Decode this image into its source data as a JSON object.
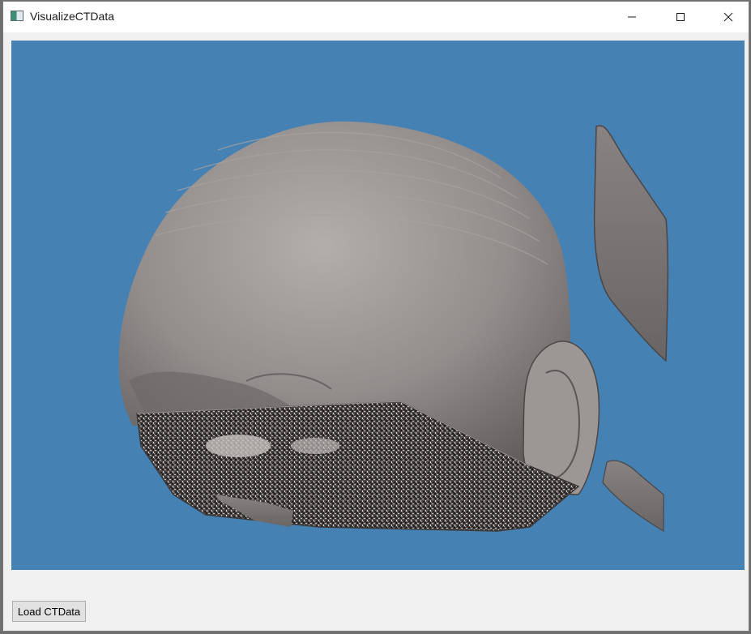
{
  "window": {
    "title": "VisualizeCTData",
    "icon": "app-window-icon"
  },
  "controls": {
    "minimize_icon": "minimize-icon",
    "maximize_icon": "maximize-icon",
    "close_icon": "close-icon"
  },
  "viewport": {
    "background_color": "#4681b4",
    "surface_color": "#8f8a89",
    "content": "3D CT head surface rendering"
  },
  "toolbar": {
    "load_button_label": "Load CTData"
  }
}
